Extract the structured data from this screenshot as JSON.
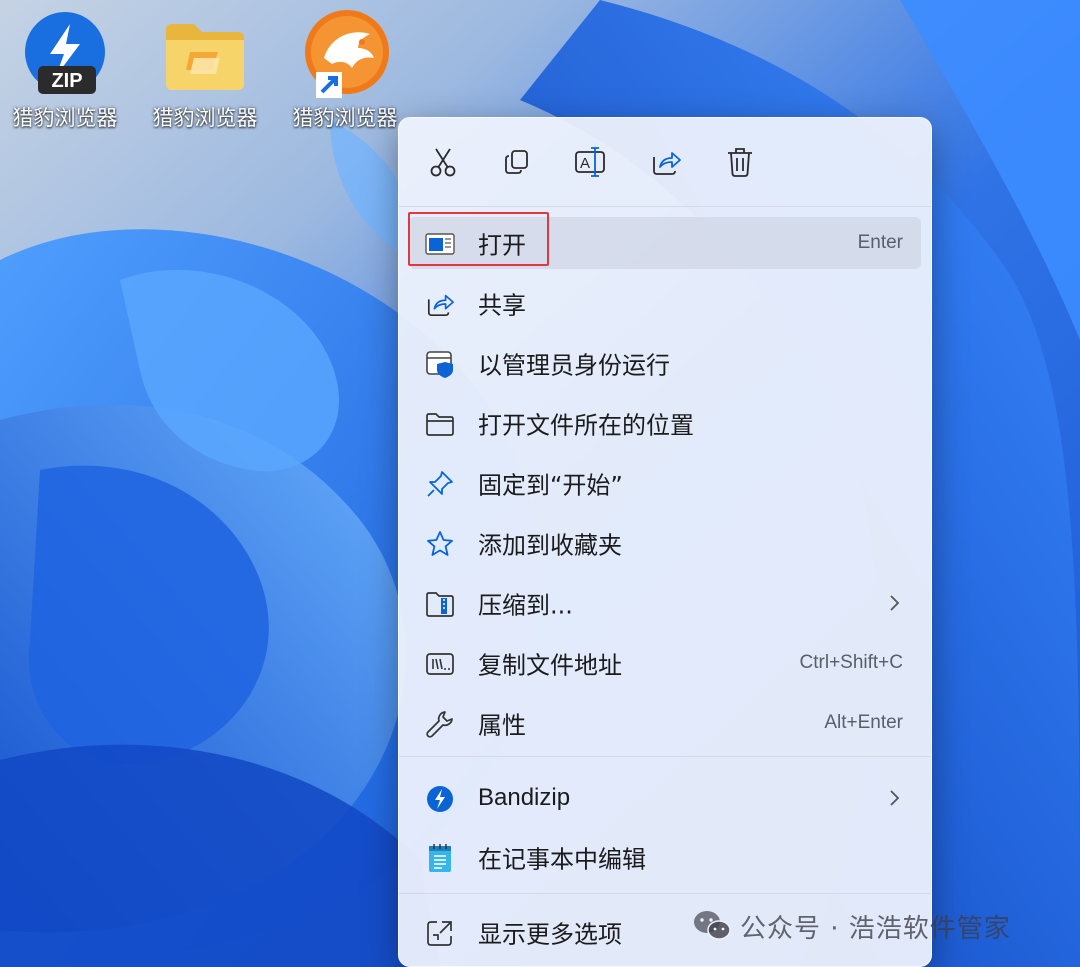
{
  "desktop": {
    "icons": [
      {
        "label": "猎豹浏览器",
        "icon": "bandizip-zip-icon"
      },
      {
        "label": "猎豹浏览器",
        "icon": "folder-icon"
      },
      {
        "label": "猎豹浏览器",
        "icon": "cheetah-browser-shortcut-icon"
      }
    ],
    "zip_badge_text": "ZIP"
  },
  "context_menu": {
    "toolbar": [
      {
        "name": "cut-icon",
        "tooltip": "cut"
      },
      {
        "name": "copy-icon",
        "tooltip": "copy"
      },
      {
        "name": "rename-icon",
        "tooltip": "rename"
      },
      {
        "name": "share-icon",
        "tooltip": "share"
      },
      {
        "name": "delete-icon",
        "tooltip": "delete"
      }
    ],
    "items": [
      {
        "label": "打开",
        "shortcut": "Enter",
        "icon": "open-window-icon",
        "highlighted": true
      },
      {
        "label": "共享",
        "shortcut": "",
        "icon": "share-icon"
      },
      {
        "label": "以管理员身份运行",
        "shortcut": "",
        "icon": "admin-shield-icon"
      },
      {
        "label": "打开文件所在的位置",
        "shortcut": "",
        "icon": "folder-open-icon"
      },
      {
        "label": "固定到“开始”",
        "shortcut": "",
        "icon": "pin-icon"
      },
      {
        "label": "添加到收藏夹",
        "shortcut": "",
        "icon": "star-icon"
      },
      {
        "label": "压缩到...",
        "shortcut": "",
        "icon": "zip-folder-icon",
        "submenu": true
      },
      {
        "label": "复制文件地址",
        "shortcut": "Ctrl+Shift+C",
        "icon": "copy-path-icon"
      },
      {
        "label": "属性",
        "shortcut": "Alt+Enter",
        "icon": "wrench-icon"
      },
      {
        "label": "Bandizip",
        "shortcut": "",
        "icon": "bandizip-icon",
        "submenu": true
      },
      {
        "label": "在记事本中编辑",
        "shortcut": "",
        "icon": "notepad-icon"
      },
      {
        "label": "显示更多选项",
        "shortcut": "",
        "icon": "more-options-icon"
      }
    ]
  },
  "watermark": {
    "text": "公众号 · 浩浩软件管家",
    "icon": "wechat-icon"
  },
  "colors": {
    "accent_blue": "#0a64d6",
    "highlight_red": "#e0383e",
    "menu_bg": "#eef2fc"
  }
}
